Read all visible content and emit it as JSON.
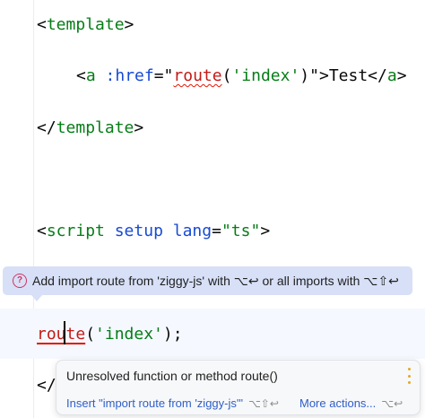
{
  "editor": {
    "lines": {
      "template_open": "template",
      "anchor_tag": "a",
      "anchor_attr": ":href",
      "anchor_fn": "route",
      "anchor_arg": "'index'",
      "anchor_text": "Test",
      "template_close": "template",
      "script_kw": "script",
      "script_attr_setup": "setup",
      "script_attr_lang": "lang",
      "script_lang_value": "\"ts\"",
      "route_fn": "route",
      "route_arg": "'index'",
      "closing_fragment": "</"
    }
  },
  "hint": {
    "icon": "question-circle-icon",
    "text": "Add import route from 'ziggy-js' with ⌥↩ or all imports with ⌥⇧↩"
  },
  "popup": {
    "title": "Unresolved function or method route()",
    "action_primary": "Insert \"import route from 'ziggy-js'\"",
    "action_primary_shortcut": "⌥⇧↩",
    "action_more": "More actions...",
    "action_more_shortcut": "⌥↩"
  }
}
